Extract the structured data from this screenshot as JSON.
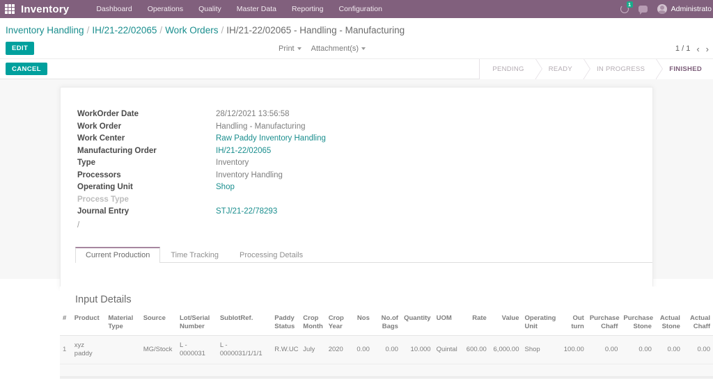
{
  "navbar": {
    "apps_icon": "apps-grid-icon",
    "brand": "Inventory",
    "menu": [
      {
        "label": "Dashboard"
      },
      {
        "label": "Operations"
      },
      {
        "label": "Quality"
      },
      {
        "label": "Master Data"
      },
      {
        "label": "Reporting"
      },
      {
        "label": "Configuration"
      }
    ],
    "activity_badge": "1",
    "user_name": "Administrato",
    "bg_color": "#81607d"
  },
  "breadcrumb": {
    "items": [
      {
        "label": "Inventory Handling",
        "link": true
      },
      {
        "label": "IH/21-22/02065",
        "link": true
      },
      {
        "label": "Work Orders",
        "link": true
      },
      {
        "label": "IH/21-22/02065 - Handling - Manufacturing",
        "link": false
      }
    ],
    "separator": "/"
  },
  "control_panel": {
    "edit_label": "EDIT",
    "cancel_label": "CANCEL",
    "print_label": "Print",
    "attachments_label": "Attachment(s)",
    "pager_text": "1 / 1",
    "prev_icon": "chevron-left-icon",
    "next_icon": "chevron-right-icon"
  },
  "statusbar": {
    "stages": [
      {
        "label": "PENDING",
        "active": false
      },
      {
        "label": "READY",
        "active": false
      },
      {
        "label": "IN PROGRESS",
        "active": false
      },
      {
        "label": "FINISHED",
        "active": true
      }
    ],
    "active_color": "#7c5d79"
  },
  "form": {
    "fields": [
      {
        "label": "WorkOrder Date",
        "value": "28/12/2021 13:56:58",
        "link": false,
        "muted": false
      },
      {
        "label": "Work Order",
        "value": "Handling - Manufacturing",
        "link": false,
        "muted": false
      },
      {
        "label": "Work Center",
        "value": "Raw Paddy Inventory Handling",
        "link": true,
        "muted": false
      },
      {
        "label": "Manufacturing Order",
        "value": "IH/21-22/02065",
        "link": true,
        "muted": false
      },
      {
        "label": "Type",
        "value": "Inventory",
        "link": false,
        "muted": false
      },
      {
        "label": "Processors",
        "value": "Inventory Handling",
        "link": false,
        "muted": false
      },
      {
        "label": "Operating Unit",
        "value": "Shop",
        "link": true,
        "muted": false
      },
      {
        "label": "Process Type",
        "value": "",
        "link": false,
        "muted": true
      },
      {
        "label": "Journal Entry",
        "value": "STJ/21-22/78293",
        "link": true,
        "muted": false
      }
    ],
    "trailing_slash": "/"
  },
  "tabs": [
    {
      "label": "Current Production",
      "active": true
    },
    {
      "label": "Time Tracking",
      "active": false
    },
    {
      "label": "Processing Details",
      "active": false
    }
  ],
  "input_details": {
    "title": "Input Details",
    "columns": [
      {
        "label": "#",
        "align": "left",
        "width": "1.8%"
      },
      {
        "label": "Product",
        "align": "left",
        "width": "5.2%"
      },
      {
        "label": "Material Type",
        "align": "left",
        "width": "5.4%"
      },
      {
        "label": "Source",
        "align": "left",
        "width": "5.6%"
      },
      {
        "label": "Lot/Serial Number",
        "align": "left",
        "width": "6.2%"
      },
      {
        "label": "SublotRef.",
        "align": "left",
        "width": "8.4%"
      },
      {
        "label": "Paddy Status",
        "align": "left",
        "width": "4.4%"
      },
      {
        "label": "Crop Month",
        "align": "left",
        "width": "3.9%"
      },
      {
        "label": "Crop Year",
        "align": "left",
        "width": "3.6%"
      },
      {
        "label": "Nos",
        "align": "right",
        "width": "3.6%"
      },
      {
        "label": "No.of Bags",
        "align": "right",
        "width": "4.4%"
      },
      {
        "label": "Quantity",
        "align": "right",
        "width": "5.0%"
      },
      {
        "label": "UOM",
        "align": "left",
        "width": "4.4%"
      },
      {
        "label": "Rate",
        "align": "right",
        "width": "4.2%"
      },
      {
        "label": "Value",
        "align": "right",
        "width": "5.0%"
      },
      {
        "label": "Operating Unit",
        "align": "left",
        "width": "5.6%"
      },
      {
        "label": "Out turn",
        "align": "right",
        "width": "4.4%"
      },
      {
        "label": "Purchase Chaff",
        "align": "right",
        "width": "5.2%"
      },
      {
        "label": "Purchase Stone",
        "align": "right",
        "width": "5.2%"
      },
      {
        "label": "Actual Stone",
        "align": "right",
        "width": "4.4%"
      },
      {
        "label": "Actual Chaff",
        "align": "right",
        "width": "4.4%"
      }
    ],
    "rows": [
      {
        "index": "1",
        "product": "xyz paddy",
        "material_type": "",
        "source": "MG/Stock",
        "lot_serial_number": "L - 0000031",
        "sublot_ref": "L - 0000031/1/1/1",
        "paddy_status": "R.W.UC",
        "crop_month": "July",
        "crop_year": "2020",
        "nos": "0.00",
        "no_of_bags": "0.00",
        "quantity": "10.000",
        "uom": "Quintal",
        "rate": "600.00",
        "value": "6,000.00",
        "operating_unit": "Shop",
        "out_turn": "100.00",
        "purchase_chaff": "0.00",
        "purchase_stone": "0.00",
        "actual_stone": "0.00",
        "actual_chaff": "0.00"
      }
    ]
  }
}
